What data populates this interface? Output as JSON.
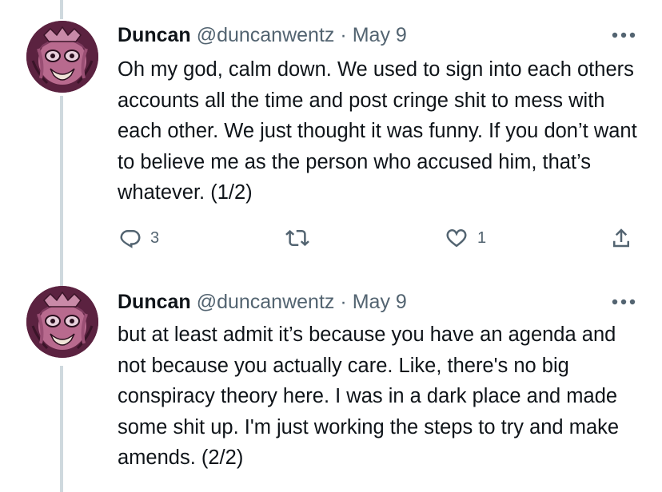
{
  "colors": {
    "text": "#0f1419",
    "secondary": "#536471",
    "thread_line": "#cfd9de"
  },
  "tweets": [
    {
      "author_name": "Duncan",
      "handle": "@duncanwentz",
      "separator": "·",
      "date": "May 9",
      "text": "Oh my god, calm down. We used to sign into each others accounts all the time and post cringe shit to mess with each other. We just thought it was funny. If you don’t want to believe me as the person who accused him, that’s whatever. (1/2)",
      "reply_count": "3",
      "retweet_count": "",
      "like_count": "1",
      "icons": [
        "reply-icon",
        "retweet-icon",
        "like-icon",
        "share-icon",
        "more-icon"
      ]
    },
    {
      "author_name": "Duncan",
      "handle": "@duncanwentz",
      "separator": "·",
      "date": "May 9",
      "text": "but at least admit it’s because you have an agenda and not because you actually care. Like, there's no big conspiracy theory here. I was in a dark place and made some shit up. I'm just working the steps to try and make amends. (2/2)",
      "icons": [
        "more-icon"
      ]
    }
  ]
}
